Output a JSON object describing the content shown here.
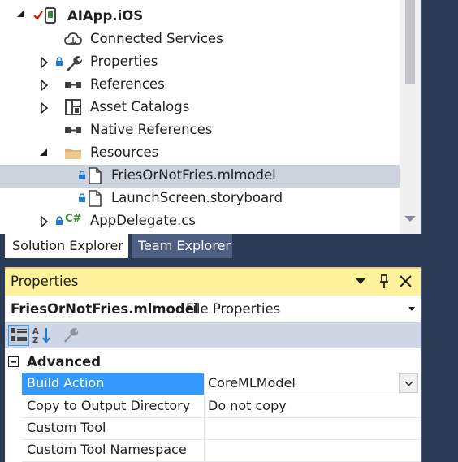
{
  "solution_explorer": {
    "items": [
      {
        "label": "AIApp.iOS",
        "icon": "ios-project-icon"
      },
      {
        "label": "Connected Services",
        "icon": "cloud-icon"
      },
      {
        "label": "Properties",
        "icon": "wrench-icon"
      },
      {
        "label": "References",
        "icon": "references-icon"
      },
      {
        "label": "Asset Catalogs",
        "icon": "asset-catalog-icon"
      },
      {
        "label": "Native References",
        "icon": "references-icon"
      },
      {
        "label": "Resources",
        "icon": "folder-icon"
      },
      {
        "label": "FriesOrNotFries.mlmodel",
        "icon": "file-icon"
      },
      {
        "label": "LaunchScreen.storyboard",
        "icon": "file-icon"
      },
      {
        "label": "AppDelegate.cs",
        "icon": "csharp-icon"
      }
    ],
    "csharp_glyph": "C#",
    "selected_index": 7
  },
  "tabs": [
    {
      "label": "Solution Explorer",
      "active": true
    },
    {
      "label": "Team Explorer",
      "active": false
    }
  ],
  "properties": {
    "title": "Properties",
    "object_name": "FriesOrNotFries.mlmodel",
    "object_type": "File Properties",
    "category": "Advanced",
    "rows": [
      {
        "name": "Build Action",
        "value": "CoreMLModel",
        "selected": true
      },
      {
        "name": "Copy to Output Directory",
        "value": "Do not copy"
      },
      {
        "name": "Custom Tool",
        "value": ""
      },
      {
        "name": "Custom Tool Namespace",
        "value": ""
      }
    ]
  },
  "colors": {
    "selection": "#cdd2dc",
    "property_selection": "#3399ff",
    "panel_title": "#fff29d",
    "background": "#2b3a55",
    "csharp": "#388a34"
  }
}
